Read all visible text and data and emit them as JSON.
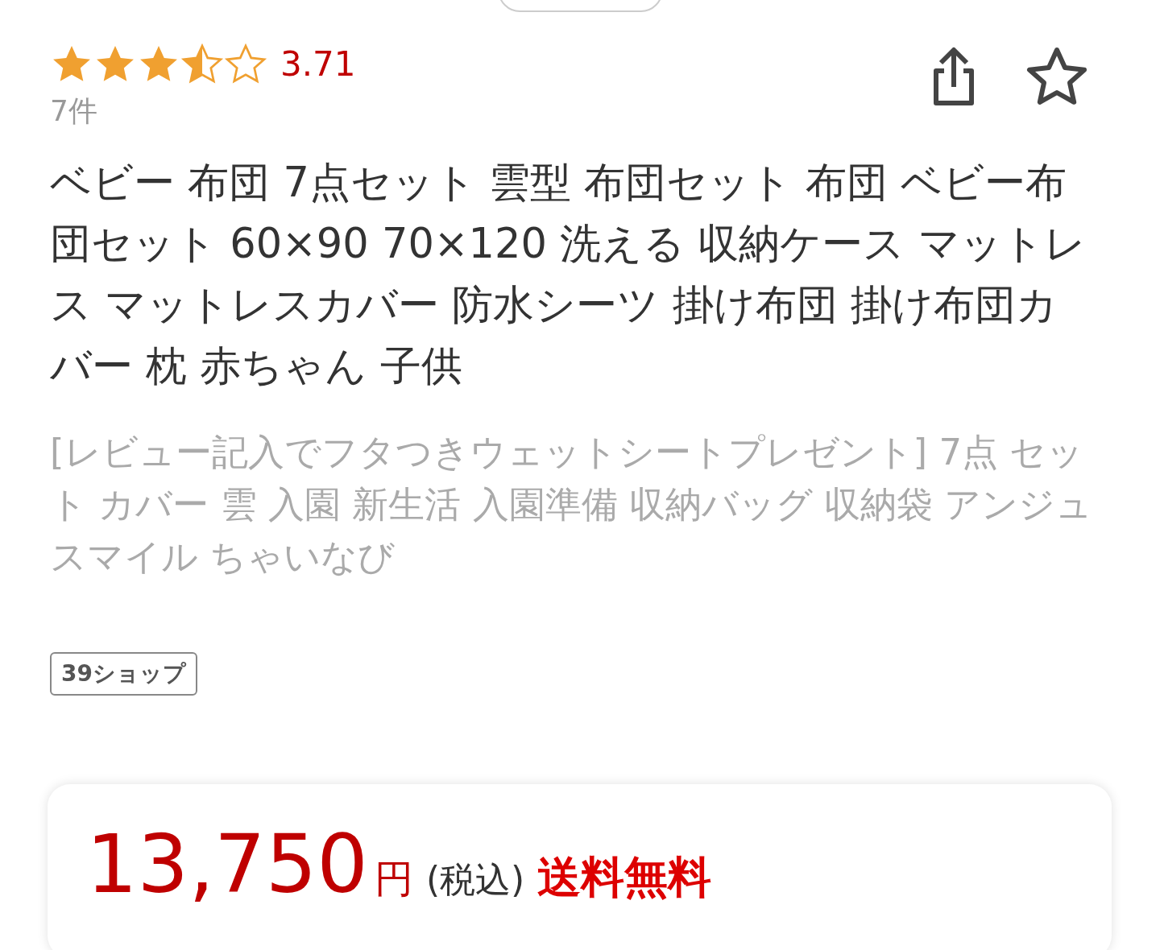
{
  "rating": {
    "stars": 3.5,
    "score": "3.71",
    "count": "7件"
  },
  "title": "ベビー 布団 7点セット 雲型 布団セット 布団 ベビー布団セット 60×90 70×120 洗える 収納ケース マットレス マットレスカバー 防水シーツ 掛け布団 掛け布団カバー 枕 赤ちゃん 子供",
  "subtitle": "[レビュー記入でフタつきウェットシートプレゼント] 7点 セット カバー 雲 入園 新生活 入園準備 収納バッグ 収納袋 アンジュスマイル ちゃいなび",
  "shop": "39ショップ",
  "price": {
    "amount": "13,750",
    "unit": "円",
    "tax": "(税込)",
    "shipping": "送料無料"
  }
}
